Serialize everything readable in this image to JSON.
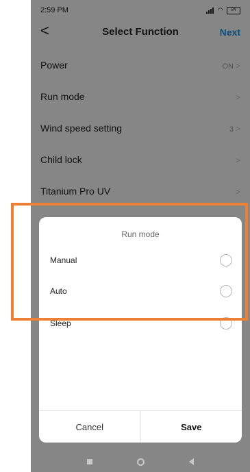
{
  "status_bar": {
    "time": "2:59 PM",
    "battery": "84"
  },
  "header": {
    "back_glyph": "<",
    "title": "Select Function",
    "next_label": "Next"
  },
  "functions": [
    {
      "label": "Power",
      "value": "ON"
    },
    {
      "label": "Run mode",
      "value": ""
    },
    {
      "label": "Wind speed setting",
      "value": "3"
    },
    {
      "label": "Child lock",
      "value": ""
    },
    {
      "label": "Titanium Pro UV",
      "value": ""
    }
  ],
  "dialog": {
    "title": "Run mode",
    "options": [
      {
        "label": "Manual",
        "selected": false
      },
      {
        "label": "Auto",
        "selected": false
      },
      {
        "label": "Sleep",
        "selected": false
      }
    ],
    "cancel_label": "Cancel",
    "save_label": "Save"
  },
  "colors": {
    "accent": "#1a8fe0",
    "highlight_frame": "#ee8033"
  }
}
